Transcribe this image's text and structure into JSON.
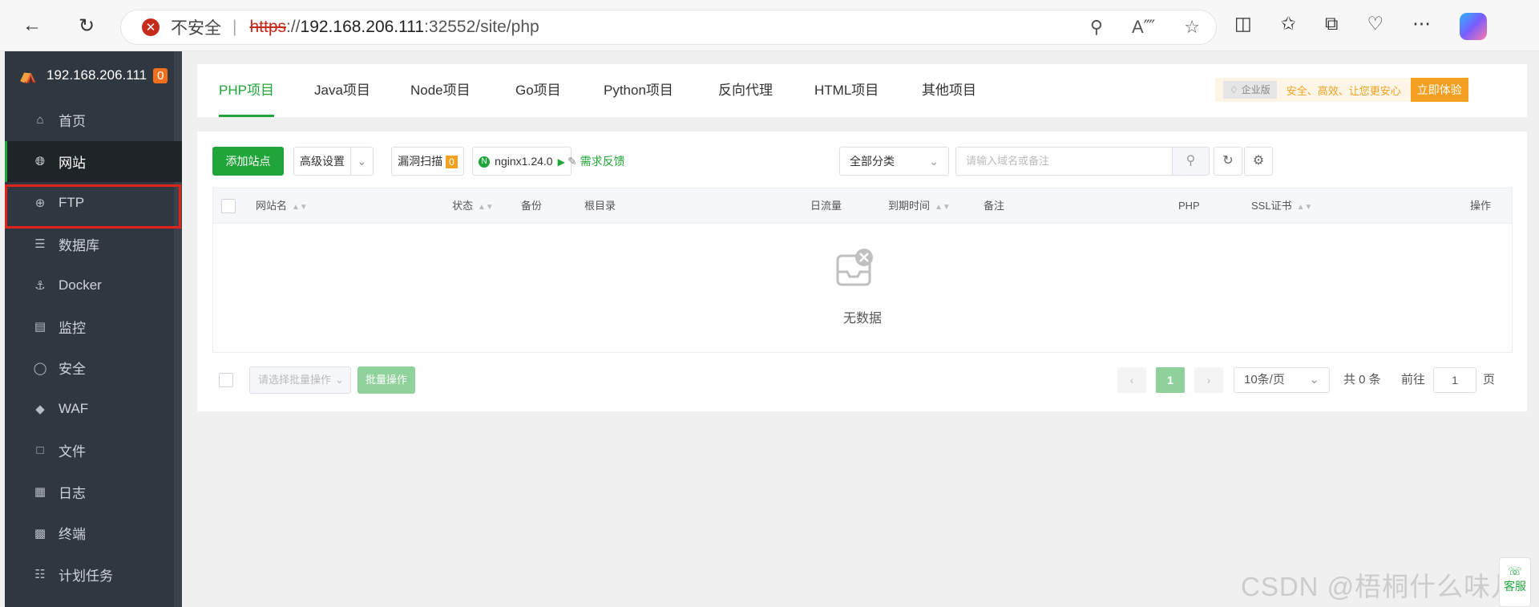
{
  "browser": {
    "security_text": "不安全",
    "url_scheme": "https",
    "url_sep": "://",
    "url_host": "192.168.206.111",
    "url_rest": ":32552/site/php"
  },
  "sidebar": {
    "server_name": "192.168.206.111",
    "badge": "0",
    "items": [
      {
        "label": "首页",
        "icon": "home-icon"
      },
      {
        "label": "网站",
        "icon": "globe-icon"
      },
      {
        "label": "FTP",
        "icon": "ftp-icon"
      },
      {
        "label": "数据库",
        "icon": "database-icon"
      },
      {
        "label": "Docker",
        "icon": "docker-icon"
      },
      {
        "label": "监控",
        "icon": "monitor-icon"
      },
      {
        "label": "安全",
        "icon": "shield-icon"
      },
      {
        "label": "WAF",
        "icon": "waf-icon"
      },
      {
        "label": "文件",
        "icon": "folder-icon"
      },
      {
        "label": "日志",
        "icon": "log-icon"
      },
      {
        "label": "终端",
        "icon": "terminal-icon"
      },
      {
        "label": "计划任务",
        "icon": "calendar-icon"
      }
    ],
    "active": "网站"
  },
  "tabs": [
    "PHP项目",
    "Java项目",
    "Node项目",
    "Go项目",
    "Python项目",
    "反向代理",
    "HTML项目",
    "其他项目"
  ],
  "promo": {
    "tag": "企业版",
    "text": "安全、高效、让您更安心",
    "button": "立即体验"
  },
  "toolbar": {
    "add_site": "添加站点",
    "advanced": "高级设置",
    "vuln_scan": "漏洞扫描",
    "vuln_count": "0",
    "nginx": "nginx1.24.0",
    "feedback": "需求反馈",
    "category": "全部分类",
    "search_placeholder": "请输入域名或备注"
  },
  "table": {
    "headers": [
      "网站名",
      "状态",
      "备份",
      "根目录",
      "日流量",
      "到期时间",
      "备注",
      "PHP",
      "SSL证书",
      "操作"
    ],
    "empty_text": "无数据"
  },
  "footer": {
    "batch_placeholder": "请选择批量操作",
    "batch_button": "批量操作",
    "current_page": "1",
    "page_size": "10条/页",
    "total": "共 0 条",
    "goto_label": "前往",
    "goto_value": "1",
    "page_unit": "页"
  },
  "watermark": "CSDN @梧桐什么味儿",
  "side_widget": "客服",
  "colors": {
    "accent": "#20a53a",
    "sidebar_bg": "#2f3740",
    "highlight": "#e0241b",
    "promo": "#f4a020"
  }
}
